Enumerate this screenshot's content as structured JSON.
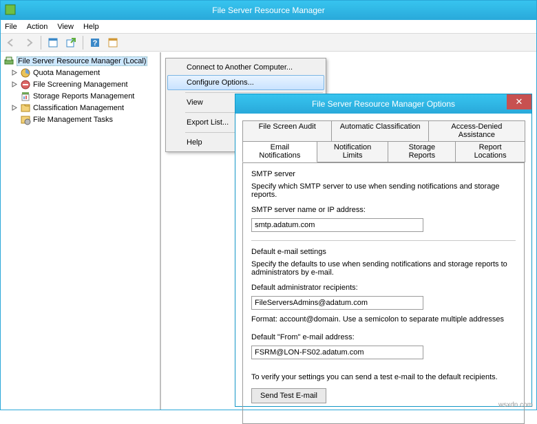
{
  "window": {
    "title": "File Server Resource Manager"
  },
  "menus": {
    "file": "File",
    "action": "Action",
    "view": "View",
    "help": "Help"
  },
  "tree": {
    "root": "File Server Resource Manager (Local)",
    "quota": "Quota Management",
    "screening": "File Screening Management",
    "storage": "Storage Reports Management",
    "classification": "Classification Management",
    "filetasks": "File Management Tasks"
  },
  "context": {
    "connect": "Connect to Another Computer...",
    "configure": "Configure Options...",
    "view": "View",
    "export": "Export List...",
    "help": "Help"
  },
  "dialog": {
    "title": "File Server Resource Manager Options",
    "close": "✕",
    "tabs_row1": {
      "audit": "File Screen Audit",
      "autoclass": "Automatic Classification",
      "access": "Access-Denied Assistance"
    },
    "tabs_row2": {
      "email": "Email Notifications",
      "limits": "Notification Limits",
      "storage": "Storage Reports",
      "locations": "Report Locations"
    },
    "smtp_header": "SMTP server",
    "smtp_help": "Specify which SMTP server to use when sending notifications and storage reports.",
    "smtp_label": "SMTP server name or IP address:",
    "smtp_value": "smtp.adatum.com",
    "defaults_header": "Default e-mail settings",
    "defaults_help": "Specify the defaults to use when sending notifications and storage reports to administrators by e-mail.",
    "admin_label": "Default administrator recipients:",
    "admin_value": "FileServersAdmins@adatum.com",
    "format_hint": "Format: account@domain. Use a semicolon to separate multiple addresses",
    "from_label": "Default \"From\" e-mail address:",
    "from_value": "FSRM@LON-FS02.adatum.com",
    "verify_text": "To verify your settings you can send a test e-mail to the default recipients.",
    "test_btn": "Send Test E-mail"
  },
  "watermark": "wsxdn.com"
}
